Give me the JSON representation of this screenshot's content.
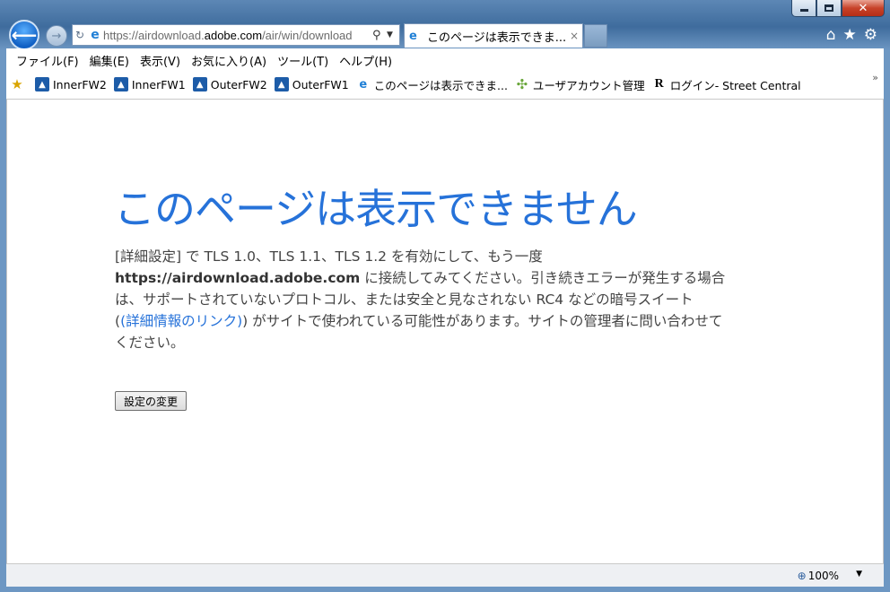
{
  "browser": {
    "address_url_prefix": "https://airdownload.",
    "address_url_domain": "adobe.com",
    "address_url_suffix": "/air/win/download",
    "tab_title": "このページは表示できま...",
    "tab_close": "×"
  },
  "menubar": {
    "items": [
      "ファイル(F)",
      "編集(E)",
      "表示(V)",
      "お気に入り(A)",
      "ツール(T)",
      "ヘルプ(H)"
    ]
  },
  "favorites": {
    "items": [
      {
        "label": "InnerFW2",
        "icon": "router-icon"
      },
      {
        "label": "InnerFW1",
        "icon": "router-icon"
      },
      {
        "label": "OuterFW2",
        "icon": "router-icon"
      },
      {
        "label": "OuterFW1",
        "icon": "router-icon"
      },
      {
        "label": "このページは表示できま...",
        "icon": "ie-icon"
      },
      {
        "label": "ユーザアカウント管理",
        "icon": "pinwheel-icon"
      },
      {
        "label": "ログイン- Street Central",
        "icon": "r-icon"
      }
    ],
    "overflow": "»"
  },
  "content": {
    "headline": "このページは表示できません",
    "line1": "[詳細設定] で TLS 1.0、TLS 1.1、TLS 1.2 を有効にして、もう一度",
    "line2_bold": "https://airdownload.adobe.com",
    "line2_rest": " に接続してみてください。引き続きエラーが発生する場合",
    "line3": "は、サポートされていないプロトコル、または安全と見なされない RC4 などの暗号スイート",
    "line4_open": "(",
    "line4_link": "(詳細情報のリンク)",
    "line4_rest": ") がサイトで使われている可能性があります。サイトの管理者に問い合わせて",
    "line5": "ください。",
    "settings_button": "設定の変更"
  },
  "statusbar": {
    "zoom": "100%"
  }
}
